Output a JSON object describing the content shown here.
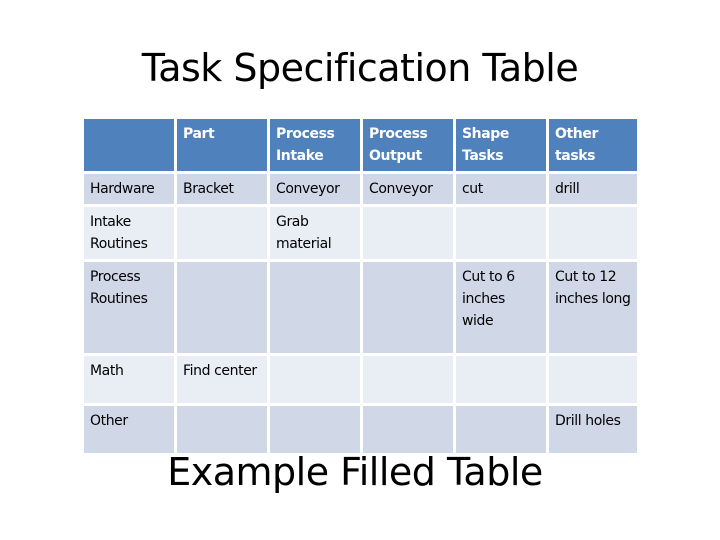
{
  "title": "Task Specification Table",
  "subtitle": "Example Filled Table",
  "colors": {
    "header_bg": "#4F81BD",
    "row_odd_bg": "#D0D8E8",
    "row_even_bg": "#E9EDF4",
    "header_text": "#FFFFFF"
  },
  "table": {
    "headers": [
      "",
      "Part",
      "Process Intake",
      "Process Output",
      "Shape Tasks",
      "Other tasks"
    ],
    "rows": [
      {
        "label": "Hardware",
        "cells": [
          "Bracket",
          "Conveyor",
          "Conveyor",
          "cut",
          "drill"
        ]
      },
      {
        "label": "Intake Routines",
        "cells": [
          "",
          "Grab material",
          "",
          "",
          ""
        ]
      },
      {
        "label": "Process Routines",
        "cells": [
          "",
          "",
          "",
          "Cut to 6 inches wide",
          "Cut to 12 inches long"
        ]
      },
      {
        "label": "Math",
        "cells": [
          "Find center",
          "",
          "",
          "",
          ""
        ]
      },
      {
        "label": "Other",
        "cells": [
          "",
          "",
          "",
          "",
          "Drill holes"
        ]
      }
    ]
  }
}
